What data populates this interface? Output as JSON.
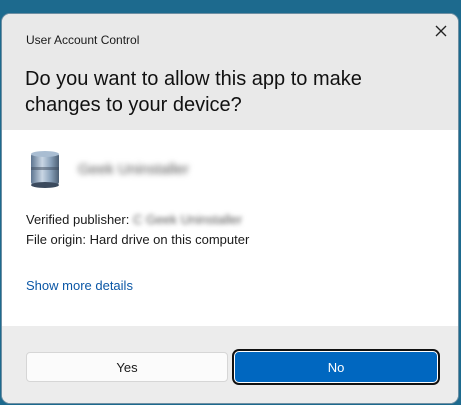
{
  "window": {
    "title": "User Account Control",
    "close_icon": "close-icon"
  },
  "prompt": {
    "question": "Do you want to allow this app to make changes to your device?"
  },
  "app": {
    "name": "Geek Uninstaller",
    "icon": "app-icon"
  },
  "info": {
    "publisher_label": "Verified publisher:",
    "publisher_value": "C Geek Uninstaller",
    "origin_label": "File origin:",
    "origin_value": "Hard drive on this computer"
  },
  "details_link": "Show more details",
  "buttons": {
    "yes": "Yes",
    "no": "No"
  },
  "colors": {
    "accent": "#0067c0",
    "link": "#0b57a6",
    "header_bg": "#e9e9e9"
  }
}
